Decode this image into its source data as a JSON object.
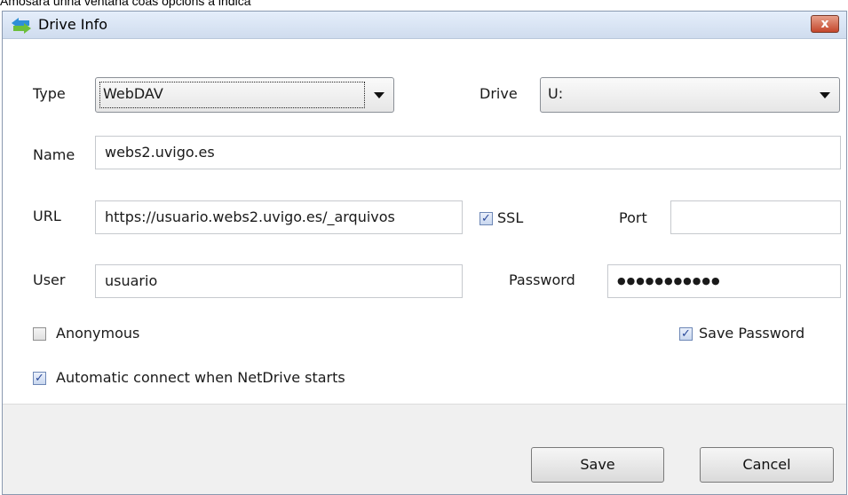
{
  "caption": "Amosará unha ventana coas opcions a indica",
  "window": {
    "title": "Drive Info",
    "close_label": "x"
  },
  "form": {
    "type_label": "Type",
    "type_value": "WebDAV",
    "drive_label": "Drive",
    "drive_value": "U:",
    "name_label": "Name",
    "name_value": "webs2.uvigo.es",
    "url_label": "URL",
    "url_value": "https://usuario.webs2.uvigo.es/_arquivos",
    "ssl_label": "SSL",
    "ssl_checked": true,
    "port_label": "Port",
    "port_value": "",
    "user_label": "User",
    "user_value": "usuario",
    "password_label": "Password",
    "password_value": "●●●●●●●●●●●",
    "anonymous_label": "Anonymous",
    "anonymous_checked": false,
    "save_password_label": "Save Password",
    "save_password_checked": true,
    "autoconnect_label": "Automatic connect when NetDrive starts",
    "autoconnect_checked": true
  },
  "buttons": {
    "save": "Save",
    "cancel": "Cancel"
  },
  "colors": {
    "titlebar": "#cfdcee",
    "close": "#c4472c",
    "footer": "#f0f0f0"
  }
}
